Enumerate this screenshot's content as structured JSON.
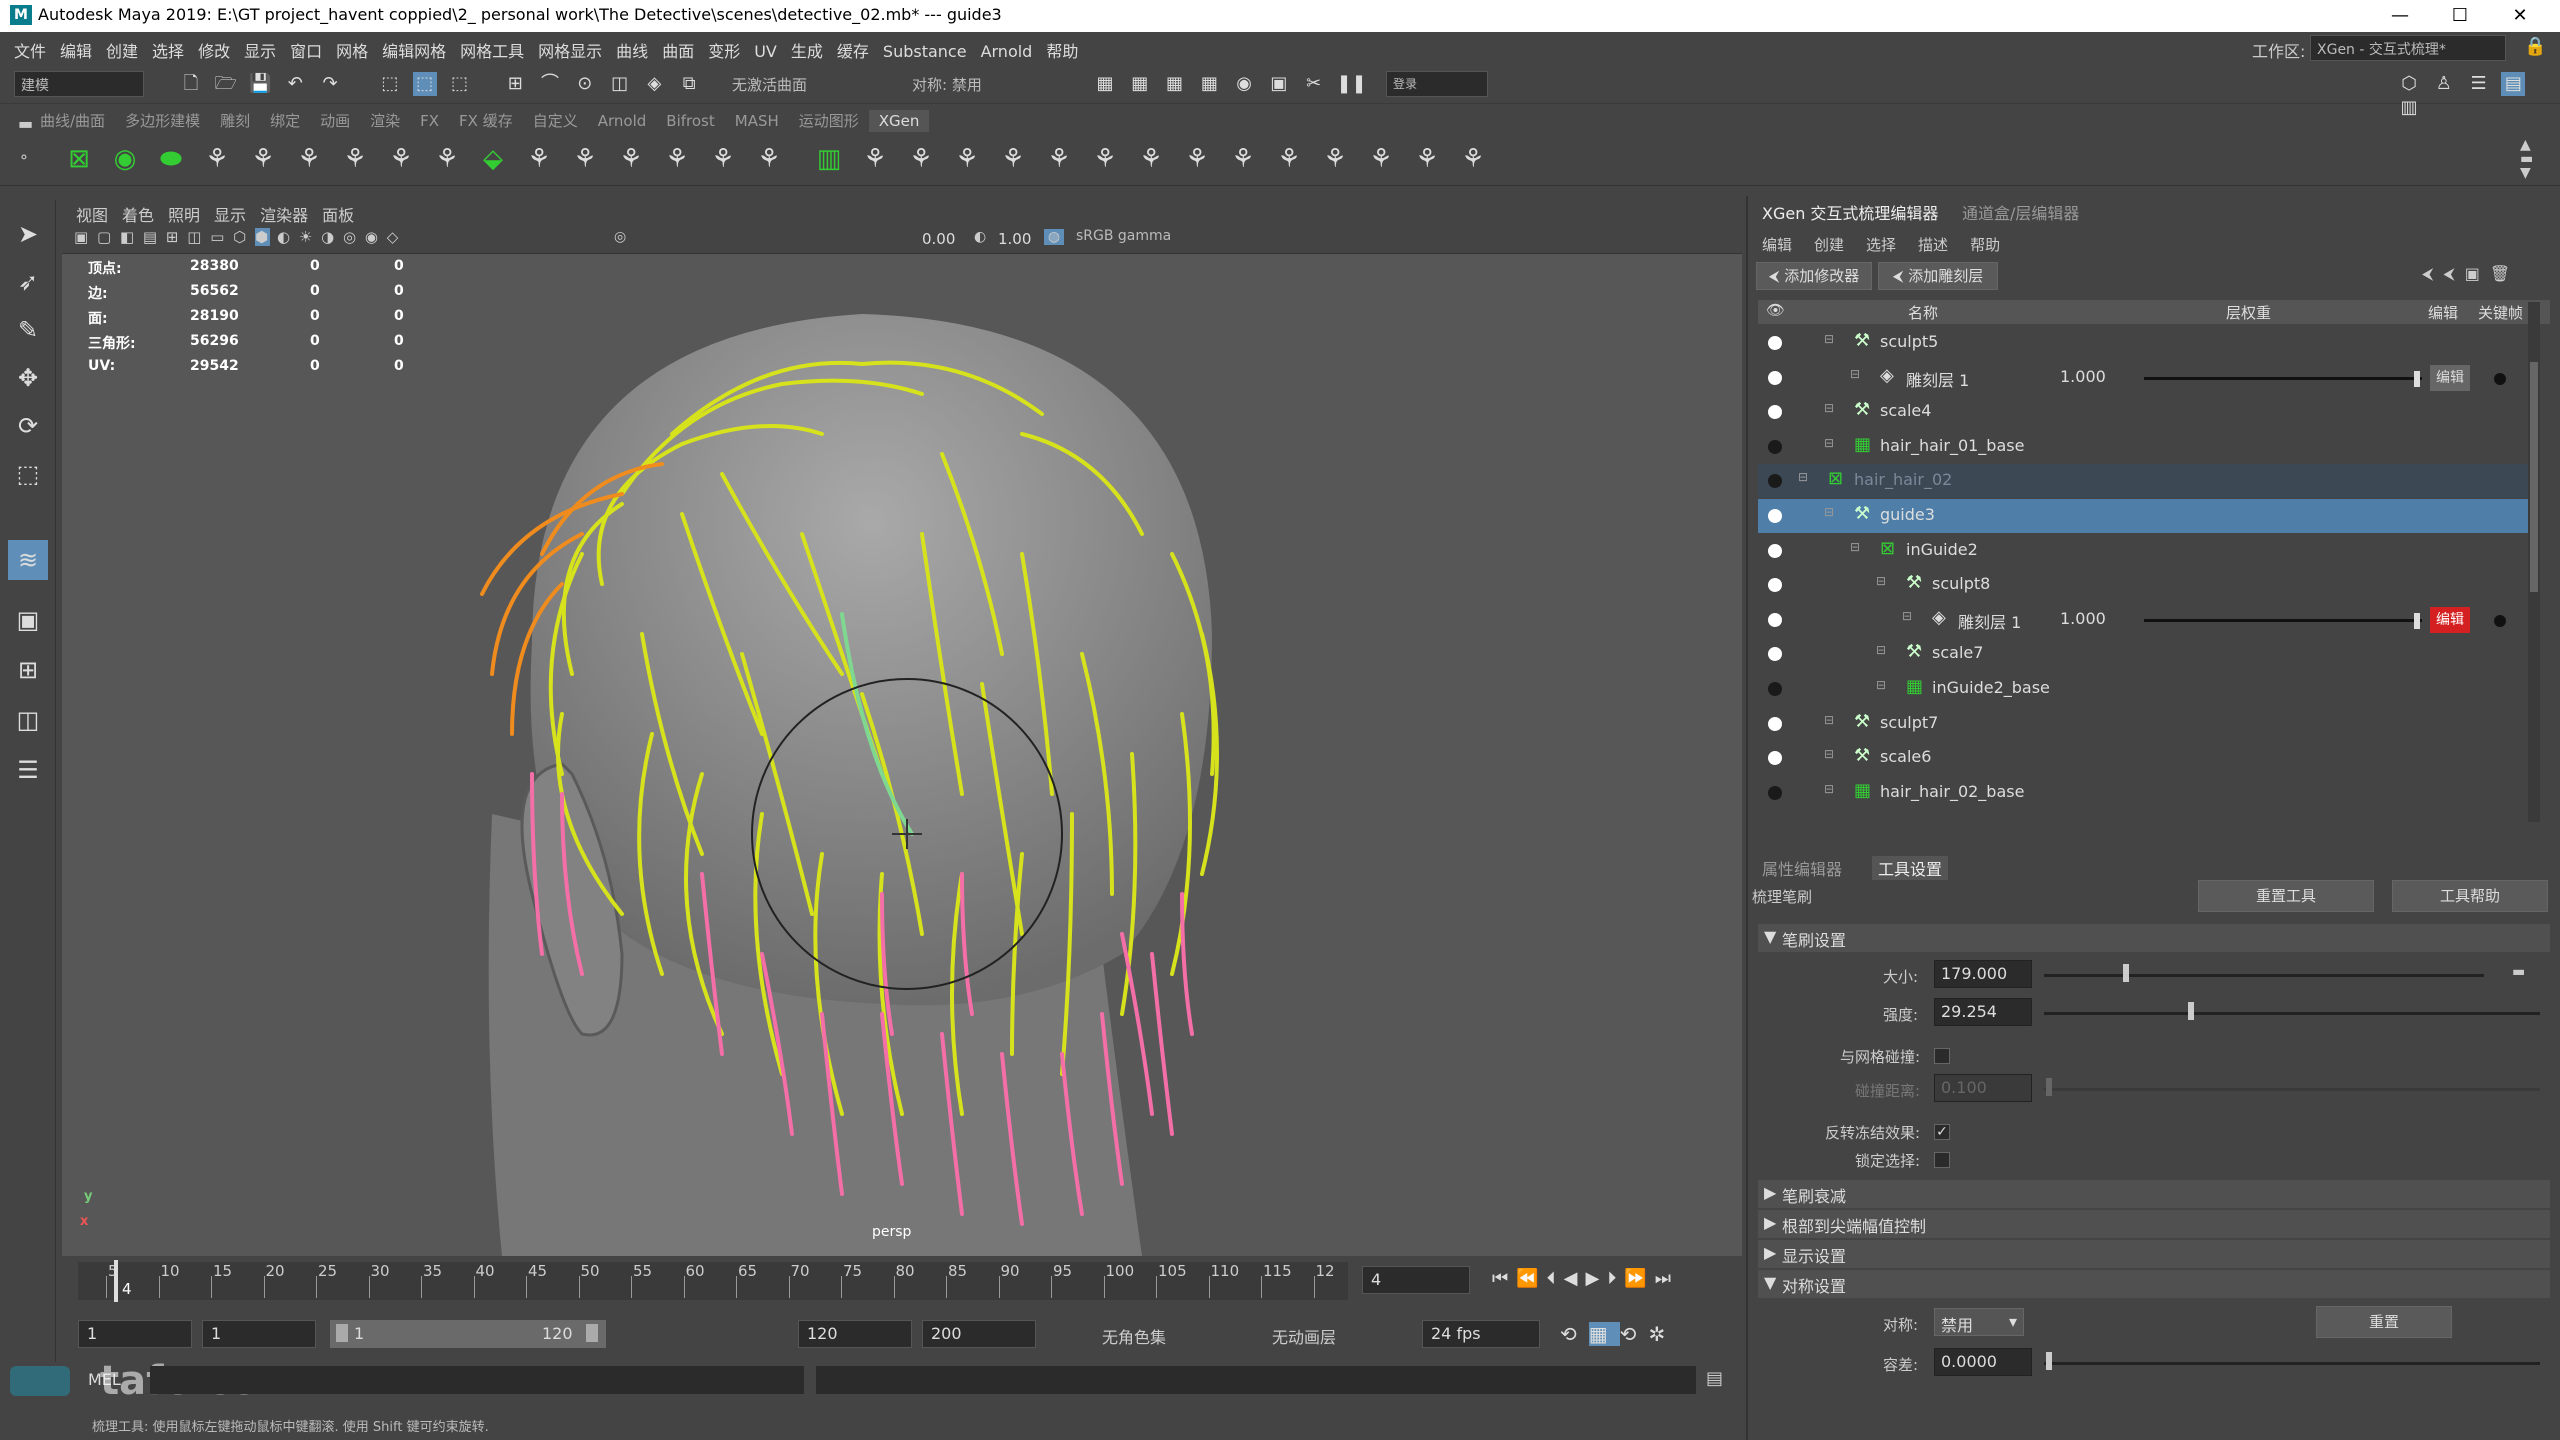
{
  "window": {
    "title": "Autodesk Maya 2019: E:\\GT project_havent coppied\\2_ personal work\\The Detective\\scenes\\detective_02.mb*  ---  guide3",
    "icon": "M"
  },
  "menubar": [
    "文件",
    "编辑",
    "创建",
    "选择",
    "修改",
    "显示",
    "窗口",
    "网格",
    "编辑网格",
    "网格工具",
    "网格显示",
    "曲线",
    "曲面",
    "变形",
    "UV",
    "生成",
    "缓存",
    "Substance",
    "Arnold",
    "帮助"
  ],
  "workspace": {
    "label": "工作区:",
    "value": "XGen - 交互式梳理*"
  },
  "status_line": {
    "mode": "建模",
    "live": "无激活曲面",
    "sym_label": "对称: 禁用",
    "login": "登录"
  },
  "shelf_tabs": [
    "曲线/曲面",
    "多边形建模",
    "雕刻",
    "绑定",
    "动画",
    "渲染",
    "FX",
    "FX 缓存",
    "自定义",
    "Arnold",
    "Bifrost",
    "MASH",
    "运动图形",
    "XGen"
  ],
  "active_shelf": "XGen",
  "viewport_menu": [
    "视图",
    "着色",
    "照明",
    "显示",
    "渲染器",
    "面板"
  ],
  "viewport_toolbar": {
    "v1": "0.00",
    "v2": "1.00",
    "colorspace": "sRGB gamma"
  },
  "hud": [
    {
      "label": "顶点:",
      "a": "28380",
      "b": "0",
      "c": "0"
    },
    {
      "label": "边:",
      "a": "56562",
      "b": "0",
      "c": "0"
    },
    {
      "label": "面:",
      "a": "28190",
      "b": "0",
      "c": "0"
    },
    {
      "label": "三角形:",
      "a": "56296",
      "b": "0",
      "c": "0"
    },
    {
      "label": "UV:",
      "a": "29542",
      "b": "0",
      "c": "0"
    }
  ],
  "camera": "persp",
  "axis": {
    "y": "y",
    "x": "x"
  },
  "timeline": {
    "ticks": [
      "5",
      "10",
      "15",
      "20",
      "25",
      "30",
      "35",
      "40",
      "45",
      "50",
      "55",
      "60",
      "65",
      "70",
      "75",
      "80",
      "85",
      "90",
      "95",
      "100",
      "105",
      "110",
      "115",
      "12"
    ],
    "current": "4",
    "frame_field": "4"
  },
  "range": {
    "start": "1",
    "start2": "1",
    "inner_start": "1",
    "inner_end": "120",
    "end": "120",
    "end2": "200",
    "charset": "无角色集",
    "anim_layer": "无动画层",
    "fps": "24 fps"
  },
  "cmdline": {
    "lang": "MEL",
    "help": "梳理工具: 使用鼠标左键拖动鼠标中键翻滚. 使用 Shift 键可约束旋转."
  },
  "watermark": "tafe.cc",
  "rightpanel": {
    "tabs": [
      "XGen 交互式梳理编辑器",
      "通道盒/层编辑器"
    ],
    "menu": [
      "编辑",
      "创建",
      "选择",
      "描述",
      "帮助"
    ],
    "add_modifier": "添加修改器",
    "add_layer": "添加雕刻层",
    "cols": {
      "name": "名称",
      "weight": "层权重",
      "edit": "编辑",
      "key": "关键帧"
    },
    "rows": [
      {
        "name": "sculpt5",
        "indent": 1,
        "eye": true,
        "icon": "sculpt"
      },
      {
        "name": "雕刻层 1",
        "indent": 2,
        "eye": true,
        "icon": "layer",
        "weight": "1.000",
        "edit": "编辑",
        "red": false
      },
      {
        "name": "scale4",
        "indent": 1,
        "eye": true,
        "icon": "scale"
      },
      {
        "name": "hair_hair_01_base",
        "indent": 1,
        "eye": false,
        "icon": "base"
      },
      {
        "name": "hair_hair_02",
        "indent": 0,
        "eye": true,
        "icon": "desc",
        "dim": true
      },
      {
        "name": "guide3",
        "indent": 1,
        "eye": true,
        "icon": "guide",
        "sel": true
      },
      {
        "name": "inGuide2",
        "indent": 2,
        "eye": true,
        "icon": "desc"
      },
      {
        "name": "sculpt8",
        "indent": 3,
        "eye": true,
        "icon": "sculpt"
      },
      {
        "name": "雕刻层 1",
        "indent": 4,
        "eye": true,
        "icon": "layer",
        "weight": "1.000",
        "edit": "编辑",
        "red": true
      },
      {
        "name": "scale7",
        "indent": 3,
        "eye": true,
        "icon": "scale"
      },
      {
        "name": "inGuide2_base",
        "indent": 3,
        "eye": false,
        "icon": "base"
      },
      {
        "name": "sculpt7",
        "indent": 1,
        "eye": true,
        "icon": "sculpt"
      },
      {
        "name": "scale6",
        "indent": 1,
        "eye": true,
        "icon": "scale"
      },
      {
        "name": "hair_hair_02_base",
        "indent": 1,
        "eye": false,
        "icon": "base"
      }
    ],
    "lower_tabs": [
      "属性编辑器",
      "工具设置"
    ],
    "tool_name": "梳理笔刷",
    "reset_tool": "重置工具",
    "tool_help": "工具帮助",
    "brush_section": "笔刷设置",
    "size_label": "大小:",
    "size_value": "179.000",
    "size_frac": 0.18,
    "strength_label": "强度:",
    "strength_value": "29.254",
    "strength_frac": 0.29,
    "collide_label": "与网格碰撞:",
    "collide_dist_label": "碰撞距离:",
    "collide_dist_value": "0.100",
    "invert_freeze_label": "反转冻结效果:",
    "lock_sel_label": "锁定选择:",
    "sec_falloff": "笔刷衰减",
    "sec_rootcontrol": "根部到尖端幅值控制",
    "sec_display": "显示设置",
    "sec_symmetry": "对称设置",
    "sym_label": "对称:",
    "sym_value": "禁用",
    "sym_reset": "重置",
    "tol_label": "容差:",
    "tol_value": "0.0000"
  }
}
